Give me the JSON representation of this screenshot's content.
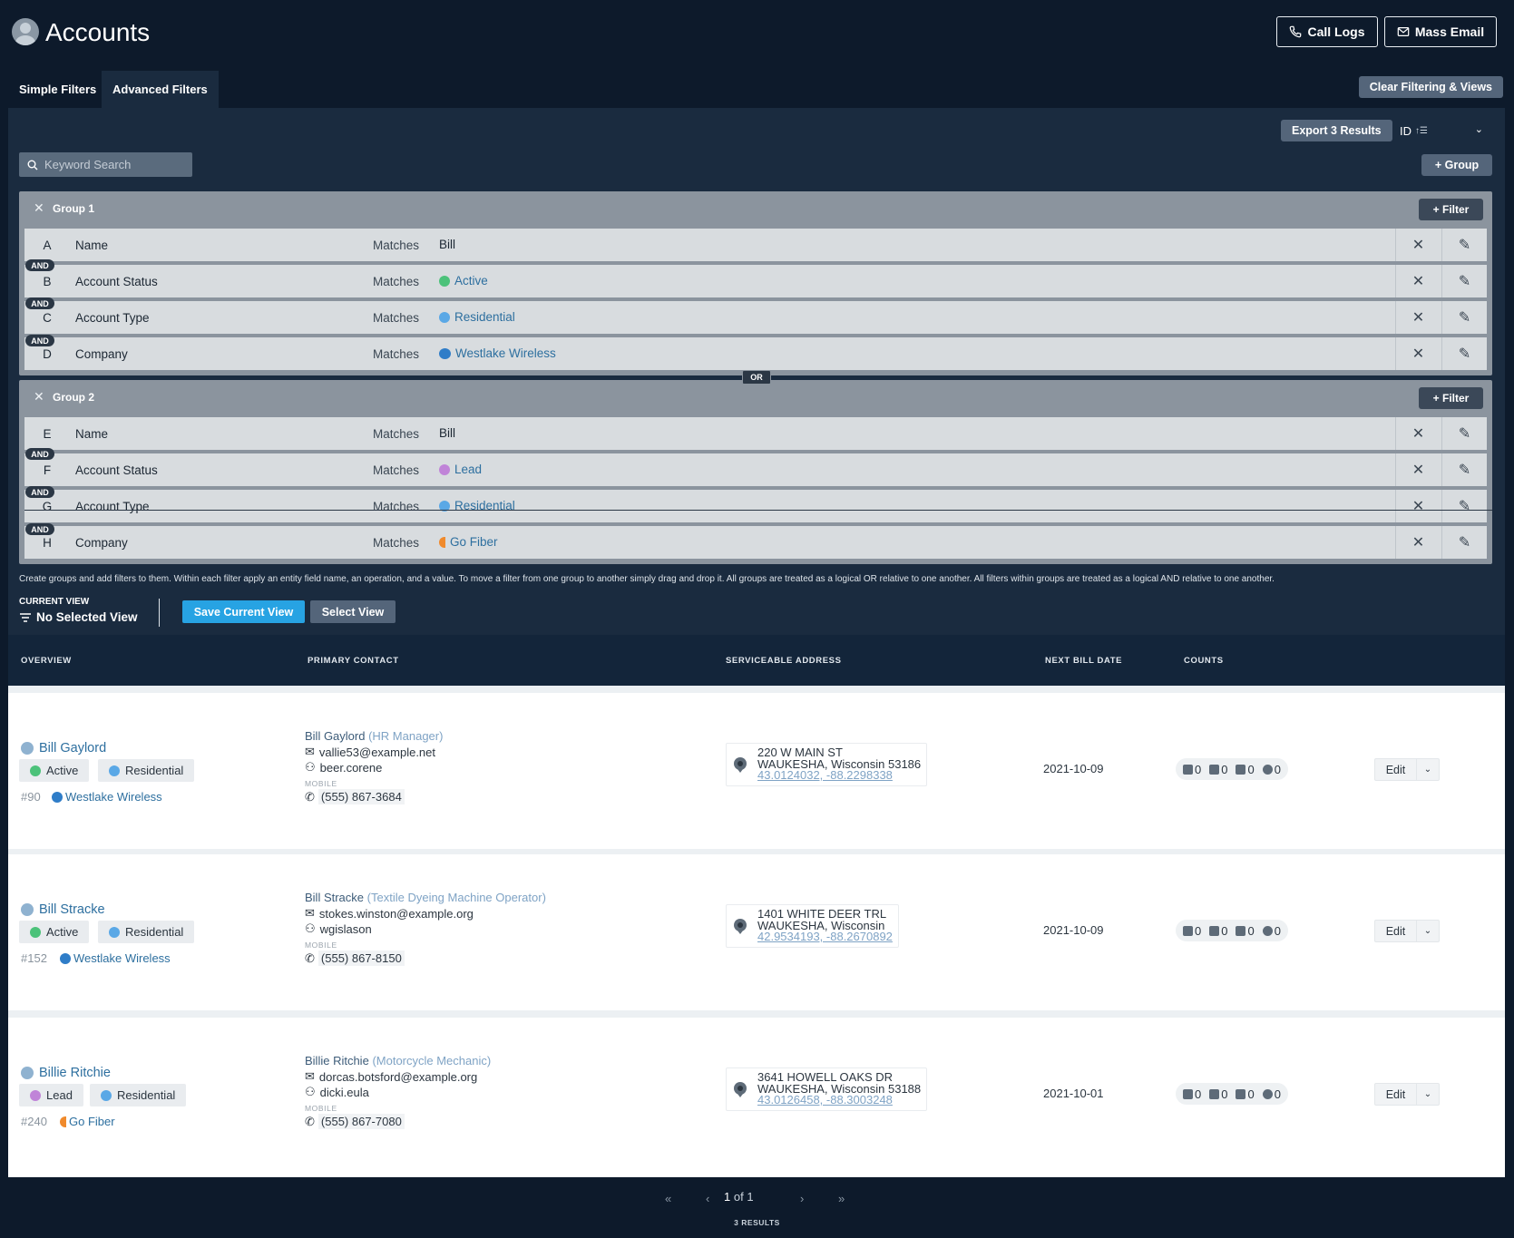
{
  "header": {
    "title": "Accounts",
    "call_logs_label": "Call Logs",
    "mass_email_label": "Mass Email"
  },
  "tabs": [
    {
      "label": "Simple Filters",
      "active": false
    },
    {
      "label": "Advanced Filters",
      "active": true
    }
  ],
  "clear_label": "Clear Filtering & Views",
  "export_label": "Export 3 Results",
  "sort": {
    "field": "ID"
  },
  "search": {
    "placeholder": "Keyword Search",
    "value": ""
  },
  "add_group_label": "+ Group",
  "add_filter_label": "+ Filter",
  "and_label": "AND",
  "or_label": "OR",
  "groups": [
    {
      "name": "Group 1",
      "filters": [
        {
          "letter": "A",
          "field": "Name",
          "op": "Matches",
          "value": "Bill"
        },
        {
          "letter": "B",
          "field": "Account Status",
          "op": "Matches",
          "value": "Active",
          "dot": "#4cc27a"
        },
        {
          "letter": "C",
          "field": "Account Type",
          "op": "Matches",
          "value": "Residential",
          "dot": "#5aa8e6"
        },
        {
          "letter": "D",
          "field": "Company",
          "op": "Matches",
          "value": "Westlake Wireless",
          "dot": "#2f7dc8"
        }
      ]
    },
    {
      "name": "Group 2",
      "filters": [
        {
          "letter": "E",
          "field": "Name",
          "op": "Matches",
          "value": "Bill"
        },
        {
          "letter": "F",
          "field": "Account Status",
          "op": "Matches",
          "value": "Lead",
          "dot": "#c084d8"
        },
        {
          "letter": "G",
          "field": "Account Type",
          "op": "Matches",
          "value": "Residential",
          "dot": "#5aa8e6"
        },
        {
          "letter": "H",
          "field": "Company",
          "op": "Matches",
          "value": "Go Fiber",
          "dot": "#f08a2c"
        }
      ]
    }
  ],
  "help_text": "Create groups and add filters to them. Within each filter apply an entity field name, an operation, and a value. To move a filter from one group to another simply drag and drop it. All groups are treated as a logical OR relative to one another. All filters within groups are treated as a logical AND relative to one another.",
  "current_view": {
    "label": "CURRENT VIEW",
    "value": "No Selected View",
    "save_label": "Save Current View",
    "select_label": "Select View"
  },
  "table": {
    "headers": [
      "OVERVIEW",
      "PRIMARY CONTACT",
      "SERVICEABLE ADDRESS",
      "NEXT BILL DATE",
      "COUNTS"
    ],
    "mobile_label": "MOBILE",
    "edit_label": "Edit",
    "rows": [
      {
        "name": "Bill Gaylord",
        "status": "Active",
        "status_color": "#4cc27a",
        "type": "Residential",
        "type_color": "#5aa8e6",
        "id": "#90",
        "company": "Westlake Wireless",
        "company_color": "#2f7dc8",
        "contact_name": "Bill Gaylord",
        "contact_role": "(HR Manager)",
        "email": "vallie53@example.net",
        "username": "beer.corene",
        "phone": "(555) 867-3684",
        "addr1": "220 W MAIN ST",
        "addr2": "WAUKESHA, Wisconsin 53186",
        "coords": "43.0124032, -88.2298338",
        "bill_date": "2021-10-09",
        "counts": [
          "0",
          "0",
          "0",
          "0"
        ]
      },
      {
        "name": "Bill Stracke",
        "status": "Active",
        "status_color": "#4cc27a",
        "type": "Residential",
        "type_color": "#5aa8e6",
        "id": "#152",
        "company": "Westlake Wireless",
        "company_color": "#2f7dc8",
        "contact_name": "Bill Stracke",
        "contact_role": "(Textile Dyeing Machine Operator)",
        "email": "stokes.winston@example.org",
        "username": "wgislason",
        "phone": "(555) 867-8150",
        "addr1": "1401 WHITE DEER TRL",
        "addr2": "WAUKESHA, Wisconsin",
        "coords": "42.9534193, -88.2670892",
        "bill_date": "2021-10-09",
        "counts": [
          "0",
          "0",
          "0",
          "0"
        ]
      },
      {
        "name": "Billie Ritchie",
        "status": "Lead",
        "status_color": "#c084d8",
        "type": "Residential",
        "type_color": "#5aa8e6",
        "id": "#240",
        "company": "Go Fiber",
        "company_color": "#f08a2c",
        "contact_name": "Billie Ritchie",
        "contact_role": "(Motorcycle Mechanic)",
        "email": "dorcas.botsford@example.org",
        "username": "dicki.eula",
        "phone": "(555) 867-7080",
        "addr1": "3641 HOWELL OAKS DR",
        "addr2": "WAUKESHA, Wisconsin 53188",
        "coords": "43.0126458, -88.3003248",
        "bill_date": "2021-10-01",
        "counts": [
          "0",
          "0",
          "0",
          "0"
        ]
      }
    ]
  },
  "pagination": {
    "first": "«",
    "prev": "‹",
    "next": "›",
    "last": "»",
    "current": "1",
    "of_text": "of 1",
    "results": "3 RESULTS"
  }
}
